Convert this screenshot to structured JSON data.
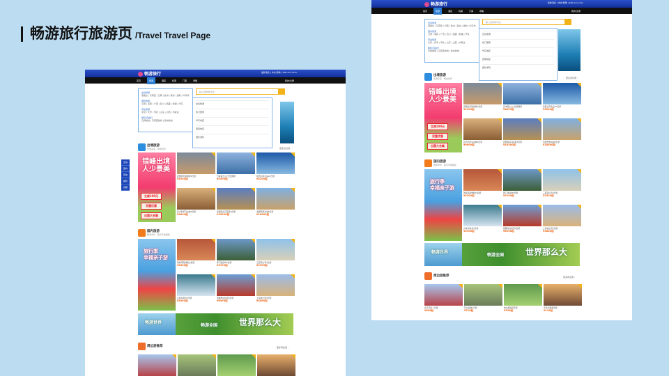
{
  "slide": {
    "title_zh": "畅游旅行旅游页",
    "title_en": "/Travel Travel Page"
  },
  "site": {
    "logo": "畅游旅行",
    "top_links": "最新消息 | 中文/简体 | 400-xxx-xxxx",
    "nav": [
      "首页",
      "旅游",
      "酒店",
      "机票",
      "门票",
      "攻略"
    ],
    "user": "我的/注册",
    "search_placeholder": "输入目的地/景点"
  },
  "category_menu": [
    {
      "head": "出境旅游",
      "items": "港澳台 | 东南亚 | 日韩 | 欧洲 | 美洲 | 澳新 | 中东非"
    },
    {
      "head": "国内旅游",
      "items": "云南 | 海南 | 广西 | 四川 | 西藏 | 新疆 | 华东"
    },
    {
      "head": "周边旅游",
      "items": "北京 | 天津 | 河北 | 山东 | 山西 | 内蒙古"
    },
    {
      "head": "邮轮/自由行",
      "items": "日韩航线 | 东南亚航线 | 欧洲航线"
    }
  ],
  "sub_menu": [
    "出境旅游",
    "热门国家",
    "华东地区",
    "西南地区",
    "国外游玩"
  ],
  "float_nav": [
    "出境",
    "国内",
    "周边",
    "邮轮",
    "顶部"
  ],
  "sections": {
    "outbound": {
      "title": "出境旅游",
      "sub": "优惠多多 · 畅游世界",
      "more": "更多出境游 ›"
    },
    "domestic": {
      "title": "国内旅游",
      "sub": "畅游中华 · 美景尽收眼底"
    },
    "nearby": {
      "title": "周边游推荐",
      "more": "更多周边游 ›"
    }
  },
  "promo_out": {
    "line1": "错峰出境",
    "line2": "人少景美",
    "tag1": "立减100元",
    "tag2": "双重优惠",
    "tag3": "出国大合集"
  },
  "promo_dom": {
    "line1": "旅行季",
    "line2": "幸福亲子游"
  },
  "banner": {
    "left": "畅游世界",
    "mid": "畅游全国",
    "right": "世界那么大"
  },
  "cards_out": [
    {
      "cap": "德国新天鹅城堡6日游",
      "price": "¥1900起",
      "c1": "#7c8a9a",
      "c2": "#c79a6a"
    },
    {
      "cap": "日本富士山7日经典游",
      "price": "¥4599起",
      "c1": "#8fb2de",
      "c2": "#3b6fa7"
    },
    {
      "cap": "新西兰南北岛10日游",
      "price": "¥3200起",
      "c1": "#1d5aa8",
      "c2": "#87b9e0"
    },
    {
      "cap": "意大利罗马古城6日游",
      "price": "¥9600起",
      "c1": "#d9b07c",
      "c2": "#8a5e34"
    },
    {
      "cap": "德国莱茵河深度8日游",
      "price": "¥16300起",
      "c1": "#5b7ec1",
      "c2": "#b79051"
    },
    {
      "cap": "法国巴黎浪漫8日游",
      "price": "¥18800起",
      "c1": "#7fb0e1",
      "c2": "#c9a26b"
    }
  ],
  "cards_dom": [
    {
      "cap": "张掖丹霞地貌七彩游",
      "price": "¥2300起",
      "c1": "#b6573a",
      "c2": "#d98757"
    },
    {
      "cap": "厦门鼓浪屿5日游",
      "price": "¥3199起",
      "c1": "#6d98c8",
      "c2": "#3c5f37"
    },
    {
      "cap": "三亚南山寺4日游",
      "price": "¥2599起",
      "c1": "#8fc2ea",
      "c2": "#d8d0b8"
    },
    {
      "cap": "九寨沟黄龙5日游",
      "price": "¥3900起",
      "c1": "#3a7a8e",
      "c2": "#d6e4f0"
    },
    {
      "cap": "西藏布达拉宫8日游",
      "price": "¥6998起",
      "c1": "#6b9fd6",
      "c2": "#b83a2a"
    },
    {
      "cap": "上海迪士尼3日游",
      "price": "¥3880起",
      "c1": "#9bbce8",
      "c2": "#d9b27a"
    }
  ],
  "cards_near": [
    {
      "cap": "北京天坛一日游",
      "price": "¥668起",
      "c1": "#a7c7ee",
      "c2": "#b7434a"
    },
    {
      "cap": "苏州园林2日游",
      "price": "¥318起",
      "c1": "#a6c47a",
      "c2": "#6b7b5a"
    },
    {
      "cap": "杭州西湖荷花游",
      "price": "¥328起",
      "c1": "#5f9a4e",
      "c2": "#a4cf70"
    },
    {
      "cap": "天津之眼夜景游",
      "price": "¥199起",
      "c1": "#e8b06a",
      "c2": "#6f4a35"
    }
  ]
}
